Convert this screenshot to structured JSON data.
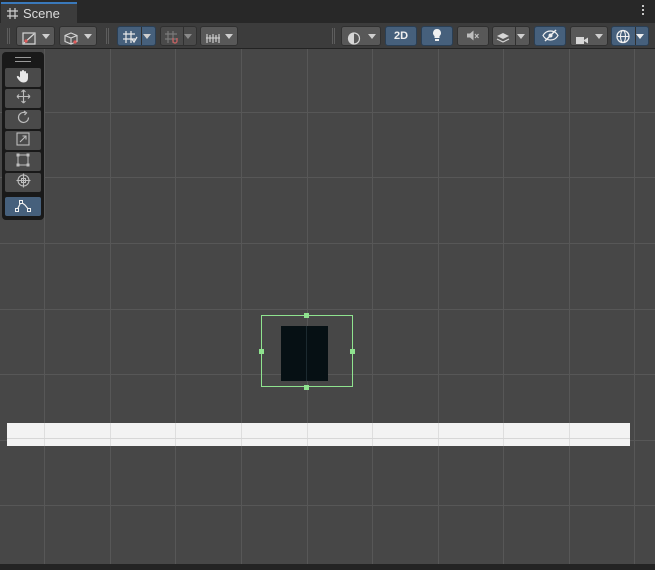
{
  "window": {
    "tab_title": "Scene",
    "tab_icon": "scene-grid-icon",
    "menu_icon": "kebab-menu-icon"
  },
  "toolbar": {
    "left_group": [
      {
        "name": "draw-mode-dropdown",
        "icon": "shaded-draw-mode-icon"
      },
      {
        "name": "object-mode-dropdown",
        "icon": "cube-icon"
      }
    ],
    "snap_group": [
      {
        "name": "grid-visibility-toggle",
        "icon": "grid-icon",
        "active": true
      },
      {
        "name": "grid-snapping-toggle",
        "icon": "snap-grid-icon",
        "active": false
      },
      {
        "name": "increment-snap-dropdown",
        "icon": "ruler-icon",
        "active": false
      }
    ],
    "mode_2d_label": "2D",
    "right_group": [
      {
        "name": "render-mode-dropdown",
        "icon": "sphere-icon"
      },
      {
        "name": "lighting-toggle",
        "icon": "lightbulb-icon",
        "active": true
      },
      {
        "name": "audio-toggle",
        "icon": "speaker-muted-icon"
      },
      {
        "name": "effects-dropdown",
        "icon": "layers-icon"
      },
      {
        "name": "scene-visibility-toggle",
        "icon": "eye-slash-icon",
        "active": true
      },
      {
        "name": "camera-settings-dropdown",
        "icon": "camera-icon"
      },
      {
        "name": "gizmos-dropdown",
        "icon": "gizmo-globe-icon",
        "active": true
      }
    ]
  },
  "tools": [
    {
      "name": "hand-tool",
      "icon": "hand-icon",
      "active": false
    },
    {
      "name": "move-tool",
      "icon": "move-arrows-icon",
      "active": false
    },
    {
      "name": "rotate-tool",
      "icon": "rotate-icon",
      "active": false
    },
    {
      "name": "scale-tool",
      "icon": "scale-icon",
      "active": false
    },
    {
      "name": "rect-tool",
      "icon": "rect-transform-icon",
      "active": false
    },
    {
      "name": "transform-tool",
      "icon": "transform-icon",
      "active": false
    },
    {
      "name": "custom-editor-tool",
      "icon": "bone-tool-icon",
      "active": true
    }
  ],
  "colors": {
    "accent": "#46607c",
    "tab_highlight": "#3a79bb",
    "selection_outline": "#8fe38f",
    "viewport_bg": "#474747",
    "ground": "#f3f3f3",
    "sprite": "#061014"
  }
}
